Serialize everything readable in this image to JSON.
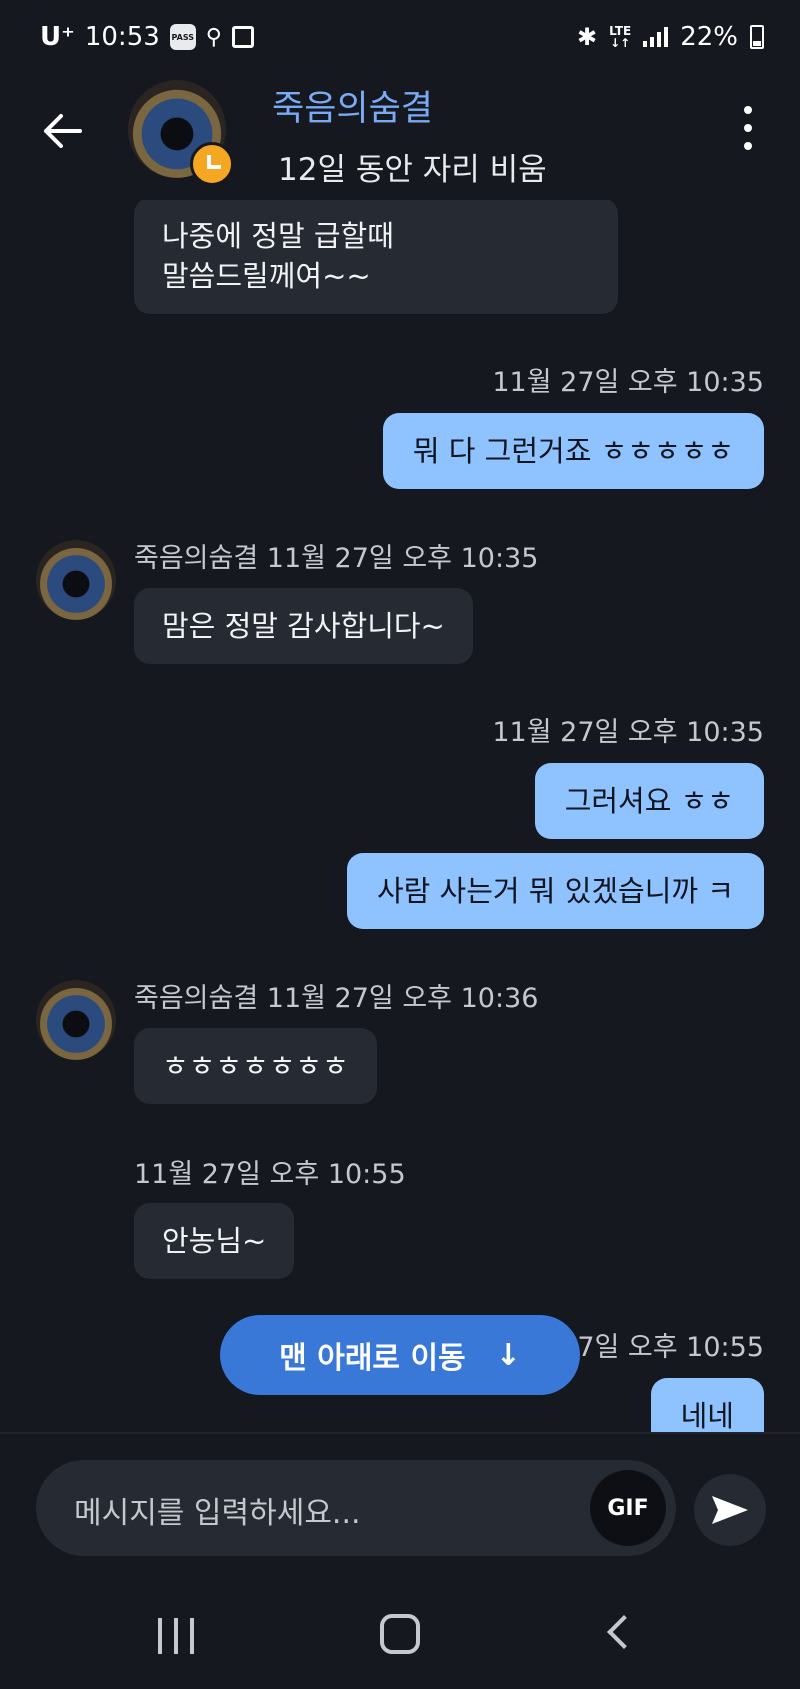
{
  "status_bar": {
    "carrier": "U⁺",
    "time": "10:53",
    "pass_label": "PASS",
    "network": "LTE",
    "battery": "22%"
  },
  "header": {
    "name": "죽음의숨결",
    "status": "12일 동안 자리 비움"
  },
  "messages": {
    "m1": {
      "text_line1": "나중에 정말 급할때",
      "text_line2": "말씀드릴께여~~"
    },
    "ts1": "11월 27일 오후 10:35",
    "m2": {
      "text": "뭐 다 그런거죠 ㅎㅎㅎㅎㅎ"
    },
    "ts2": "죽음의숨결 11월 27일 오후 10:35",
    "m3": {
      "text": "맘은 정말 감사합니다~"
    },
    "ts3": "11월 27일 오후 10:35",
    "m4": {
      "text": "그러셔요 ㅎㅎ"
    },
    "m5": {
      "text": "사람 사는거 뭐 있겠습니까 ㅋ"
    },
    "ts4": "죽음의숨결 11월 27일 오후 10:36",
    "m6": {
      "text": "ㅎㅎㅎㅎㅎㅎㅎ"
    },
    "ts5": "11월 27일 오후 10:55",
    "m7": {
      "text": "안농님~"
    },
    "ts6": "7일 오후 10:55",
    "m8": {
      "text": "네네"
    }
  },
  "jump_button": {
    "label": "맨 아래로 이동",
    "arrow": "↓"
  },
  "composer": {
    "placeholder": "메시지를 입력하세요...",
    "gif_label": "GIF"
  },
  "colors": {
    "background": "#15181f",
    "incoming_bubble": "#252a33",
    "outgoing_bubble": "#8fc3ff",
    "accent": "#3a78d8",
    "name": "#7aaaf5",
    "away": "#f5a623"
  }
}
